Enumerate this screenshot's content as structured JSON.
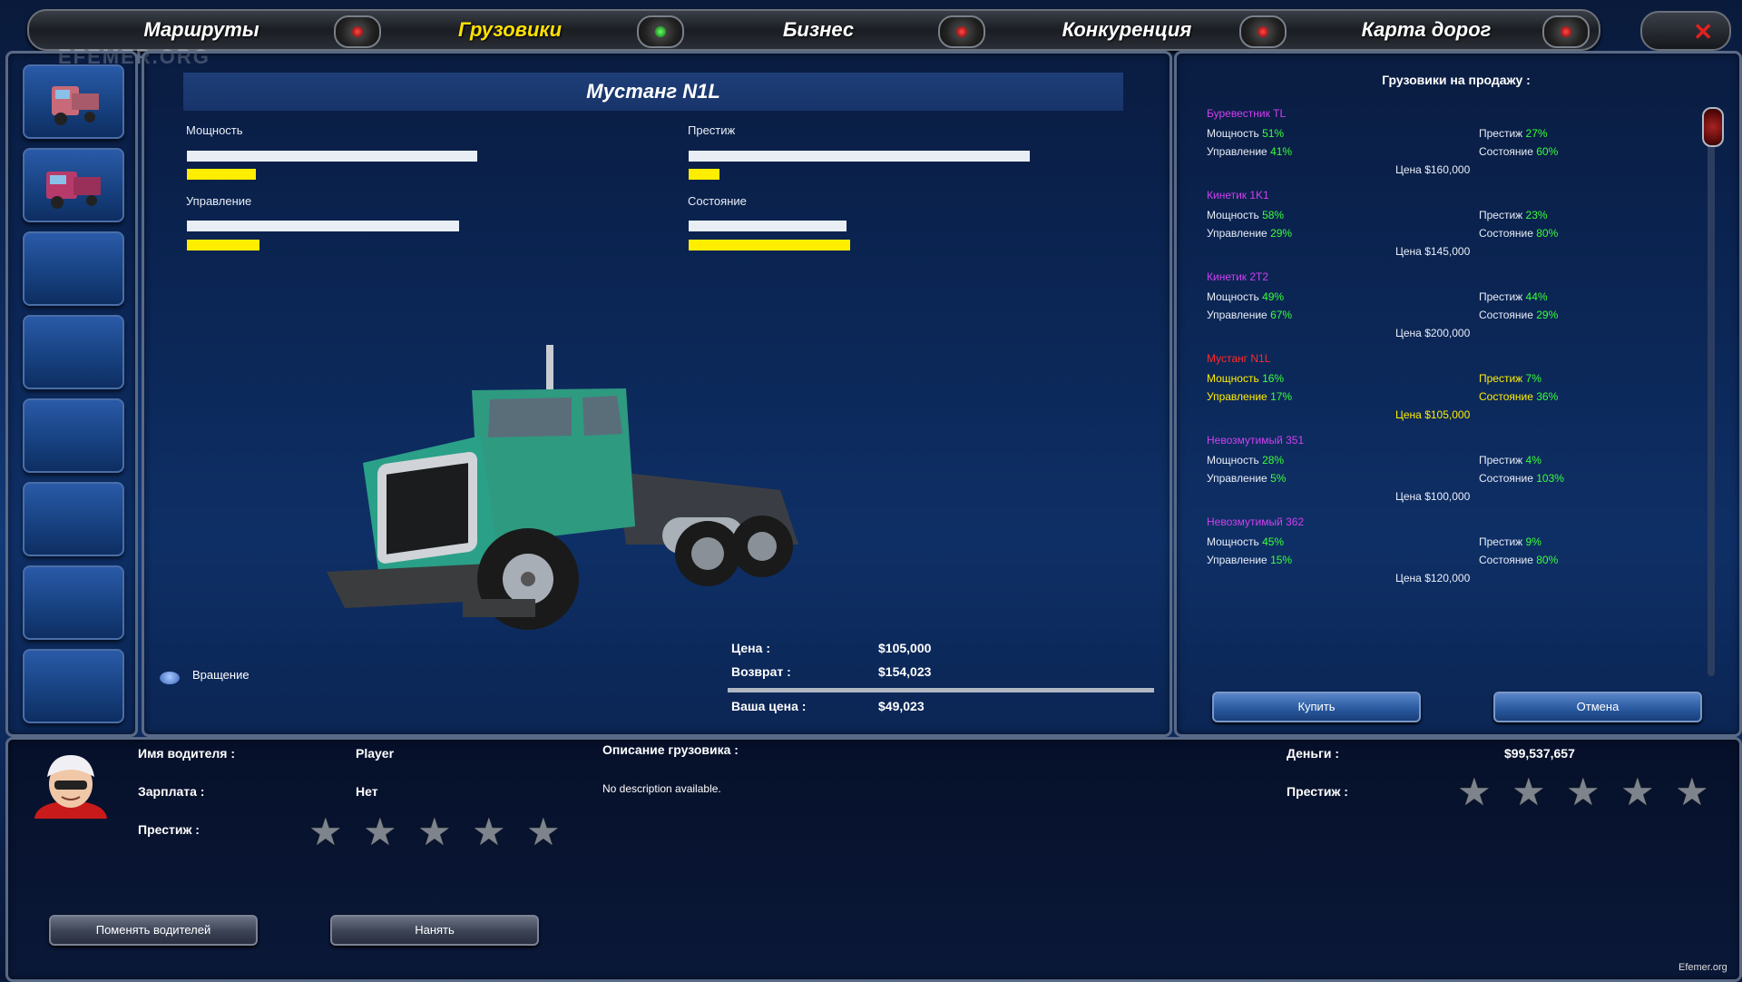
{
  "watermark": "EFEMER.ORG",
  "footer_mark": "Efemer.org",
  "nav": {
    "tabs": [
      {
        "label": "Маршруты"
      },
      {
        "label": "Грузовики"
      },
      {
        "label": "Бизнес"
      },
      {
        "label": "Конкуренция"
      },
      {
        "label": "Карта дорог"
      }
    ],
    "active_index": 1,
    "close_icon": "close-icon"
  },
  "colors": {
    "active_tab": "#ffe000",
    "bar_fill": "#ffee00",
    "bar_max": "#e8eef4",
    "stat_value": "#3aff3a",
    "name_normal": "#d040f0",
    "name_selected": "#ff2a2a"
  },
  "truck": {
    "name": "Мустанг N1L",
    "stats": {
      "power": {
        "label": "Мощность",
        "value": 16,
        "max": 51
      },
      "prestige": {
        "label": "Престиж",
        "value": 7,
        "max": 27
      },
      "control": {
        "label": "Управление",
        "value": 17,
        "max": 67
      },
      "condition": {
        "label": "Состояние",
        "value": 36,
        "max": 103
      }
    },
    "rotate_label": "Вращение",
    "price": {
      "label": "Цена :",
      "value": "$105,000"
    },
    "refund": {
      "label": "Возврат :",
      "value": "$154,023"
    },
    "your_price": {
      "label": "Ваша цена :",
      "value": "$49,023"
    }
  },
  "sale": {
    "title": "Грузовики на продажу :",
    "power_label": "Мощность",
    "prestige_label": "Престиж",
    "control_label": "Управление",
    "condition_label": "Состояние",
    "price_label": "Цена",
    "items": [
      {
        "name": "Буревестник TL",
        "power": "51%",
        "prestige": "27%",
        "control": "41%",
        "condition": "60%",
        "price": "$160,000"
      },
      {
        "name": "Кинетик 1K1",
        "power": "58%",
        "prestige": "23%",
        "control": "29%",
        "condition": "80%",
        "price": "$145,000"
      },
      {
        "name": "Кинетик 2Т2",
        "power": "49%",
        "prestige": "44%",
        "control": "67%",
        "condition": "29%",
        "price": "$200,000"
      },
      {
        "name": "Мустанг N1L",
        "power": "16%",
        "prestige": "7%",
        "control": "17%",
        "condition": "36%",
        "price": "$105,000"
      },
      {
        "name": "Невозмутимый 351",
        "power": "28%",
        "prestige": "4%",
        "control": "5%",
        "condition": "103%",
        "price": "$100,000"
      },
      {
        "name": "Невозмутимый 362",
        "power": "45%",
        "prestige": "9%",
        "control": "15%",
        "condition": "80%",
        "price": "$120,000"
      }
    ],
    "selected_index": 3,
    "buy_label": "Купить",
    "cancel_label": "Отмена"
  },
  "driver": {
    "name_label": "Имя водителя :",
    "name_value": "Player",
    "salary_label": "Зарплата :",
    "salary_value": "Нет",
    "prestige_label": "Престиж :",
    "prestige_stars": 5,
    "change_label": "Поменять водителей",
    "hire_label": "Нанять"
  },
  "description": {
    "label": "Описание грузовика :",
    "text": "No description available."
  },
  "money": {
    "label": "Деньги :",
    "value": "$99,537,657",
    "prestige_label": "Престиж :",
    "prestige_stars": 5
  }
}
